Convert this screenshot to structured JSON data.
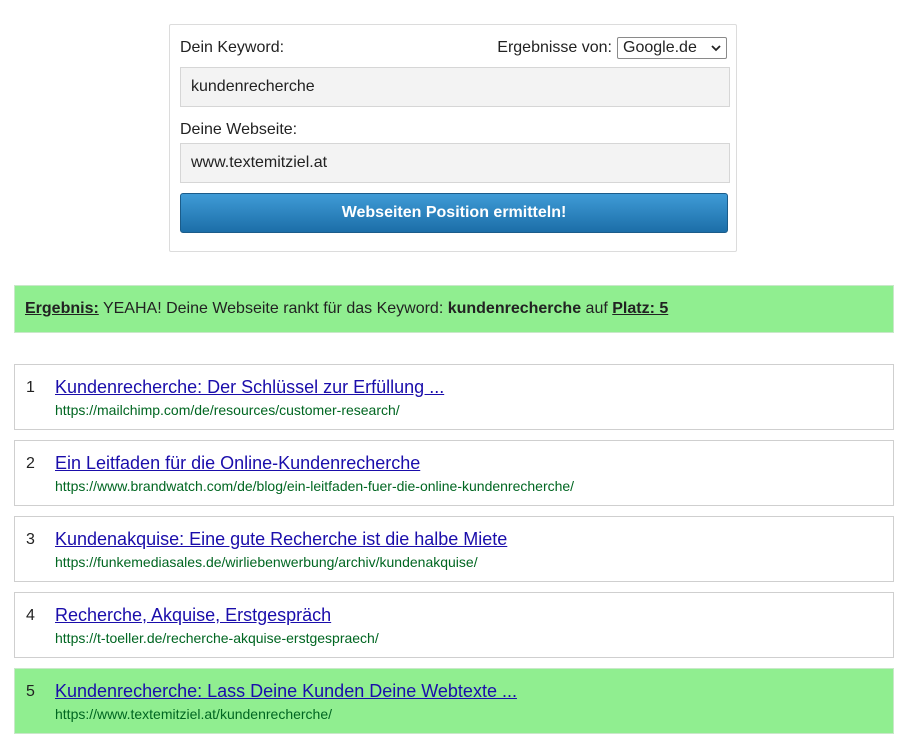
{
  "form": {
    "keyword_label": "Dein Keyword:",
    "engine_label": "Ergebnisse von:",
    "engine_selected": "Google.de",
    "keyword_value": "kundenrecherche",
    "website_label": "Deine Webseite:",
    "website_value": "www.textemitziel.at",
    "submit_label": "Webseiten Position ermitteln!"
  },
  "result": {
    "prefix": "Ergebnis:",
    "text": " YEAHA! Deine Webseite rankt für das Keyword: ",
    "keyword": "kundenrecherche",
    "mid": " auf ",
    "place": "Platz: 5",
    "color": "#90ee90"
  },
  "results": [
    {
      "rank": "1",
      "title": "Kundenrecherche: Der Schlüssel zur Erfüllung ...",
      "url": "https://mailchimp.com/de/resources/customer-research/"
    },
    {
      "rank": "2",
      "title": "Ein Leitfaden für die Online-Kundenrecherche",
      "url": "https://www.brandwatch.com/de/blog/ein-leitfaden-fuer-die-online-kundenrecherche/"
    },
    {
      "rank": "3",
      "title": "Kundenakquise: Eine gute Recherche ist die halbe Miete",
      "url": "https://funkemediasales.de/wirliebenwerbung/archiv/kundenakquise/"
    },
    {
      "rank": "4",
      "title": "Recherche, Akquise, Erstgespräch",
      "url": "https://t-toeller.de/recherche-akquise-erstgespraech/"
    },
    {
      "rank": "5",
      "title": "Kundenrecherche: Lass Deine Kunden Deine Webtexte ...",
      "url": "https://www.textemitziel.at/kundenrecherche/",
      "highlighted": true
    }
  ],
  "colors": {
    "link": "#1a0dab",
    "url": "#006621",
    "highlight": "#90ee90",
    "button": "#1c6ea8"
  }
}
